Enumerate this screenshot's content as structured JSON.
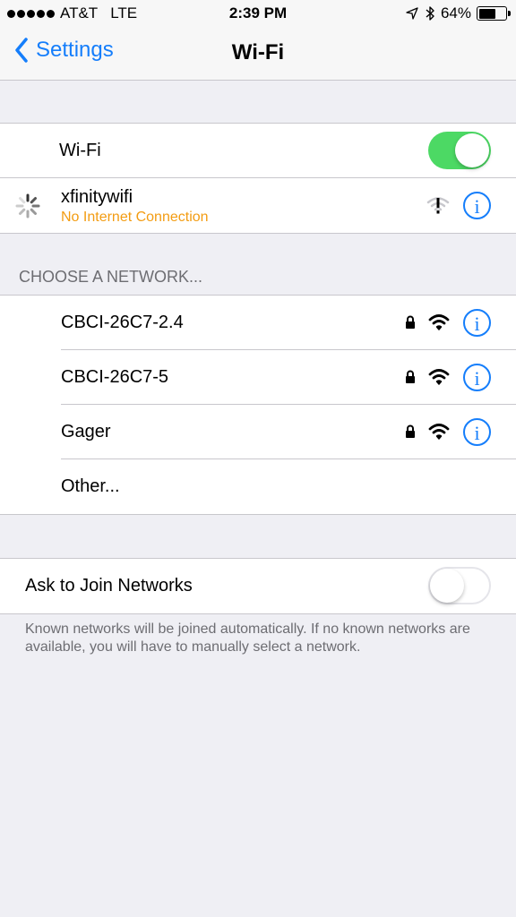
{
  "status": {
    "carrier": "AT&T",
    "network": "LTE",
    "time": "2:39 PM",
    "battery": "64%",
    "battery_level": 0.64
  },
  "nav": {
    "back_label": "Settings",
    "title": "Wi-Fi"
  },
  "wifi_toggle": {
    "label": "Wi-Fi",
    "on": true
  },
  "connected": {
    "name": "xfinitywifi",
    "status": "No Internet Connection"
  },
  "choose": {
    "header": "CHOOSE A NETWORK...",
    "networks": [
      {
        "name": "CBCI-26C7-2.4"
      },
      {
        "name": "CBCI-26C7-5"
      },
      {
        "name": "Gager"
      }
    ],
    "other_label": "Other..."
  },
  "ask": {
    "label": "Ask to Join Networks",
    "on": false,
    "note": "Known networks will be joined automatically. If no known networks are available, you will have to manually select a network."
  },
  "icons": {
    "back": "chevron-left-icon",
    "info": "info-icon",
    "lock": "lock-icon",
    "wifi": "wifi-icon",
    "spinner": "spinner-icon",
    "location": "location-arrow-icon",
    "bluetooth": "bluetooth-icon",
    "battery": "battery-icon"
  },
  "colors": {
    "accent": "#157efb",
    "toggle_on": "#4cd964",
    "warning": "#f39c12"
  }
}
